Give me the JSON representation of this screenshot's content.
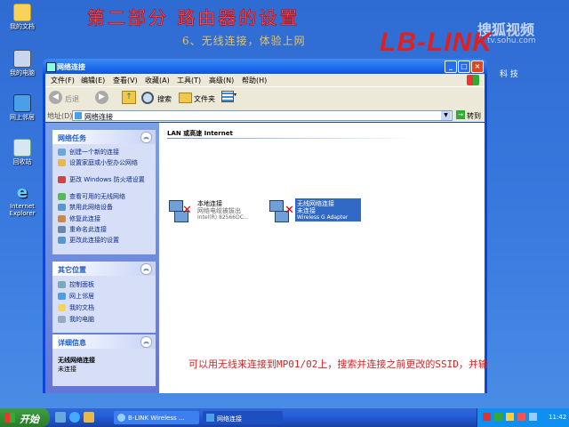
{
  "lesson": {
    "title": "第二部分   路由器的设置",
    "subtitle": "6、无线连接，体验上网",
    "brand": "LB-LINK",
    "brand_suffix": "科 技",
    "watermark": "搜狐视频",
    "watermark_url": "tv.sohu.com",
    "caption": "可以用无线来连接到MP01/02上，搜索并连接之前更改的SSID，并输"
  },
  "desktop_icons": [
    {
      "label": "我的文档",
      "icon": "folder-icon"
    },
    {
      "label": "我的电脑",
      "icon": "computer-icon"
    },
    {
      "label": "网上邻居",
      "icon": "network-places-icon"
    },
    {
      "label": "回收站",
      "icon": "recycle-bin-icon"
    },
    {
      "label": "Internet Explorer",
      "icon": "ie-icon"
    }
  ],
  "window": {
    "title": "网络连接",
    "menu": [
      "文件(F)",
      "编辑(E)",
      "查看(V)",
      "收藏(A)",
      "工具(T)",
      "高级(N)",
      "帮助(H)"
    ],
    "toolbar": {
      "back": "后退",
      "search": "搜索",
      "folders": "文件夹"
    },
    "address": {
      "label": "地址(D)",
      "value": "网络连接",
      "go": "转到"
    },
    "left_pane": {
      "network_tasks": {
        "title": "网络任务",
        "items": [
          "创建一个新的连接",
          "设置家庭或小型办公网络",
          "更改 Windows 防火墙设置",
          "查看可用的无线网络",
          "禁用此网络设备",
          "修复此连接",
          "重命名此连接",
          "更改此连接的设置"
        ]
      },
      "other_places": {
        "title": "其它位置",
        "items": [
          "控制面板",
          "网上邻居",
          "我的文档",
          "我的电脑"
        ]
      },
      "details": {
        "title": "详细信息",
        "name": "无线网络连接",
        "status": "未连接"
      }
    },
    "section_header": "LAN 或高速 Internet",
    "connections": [
      {
        "name": "本地连接",
        "status": "网络电缆被拔出",
        "device": "Intel(R) 82566DC..."
      },
      {
        "name": "无线网络连接",
        "status": "未连接",
        "device": "Wireless G Adapter"
      }
    ]
  },
  "taskbar": {
    "start": "开始",
    "items": [
      "B-LINK Wireless ...",
      "网络连接"
    ],
    "clock": "11:42"
  },
  "colors": {
    "xp_blue": "#0a46d8",
    "error_red": "#d00000",
    "caption_red": "#e02020"
  }
}
